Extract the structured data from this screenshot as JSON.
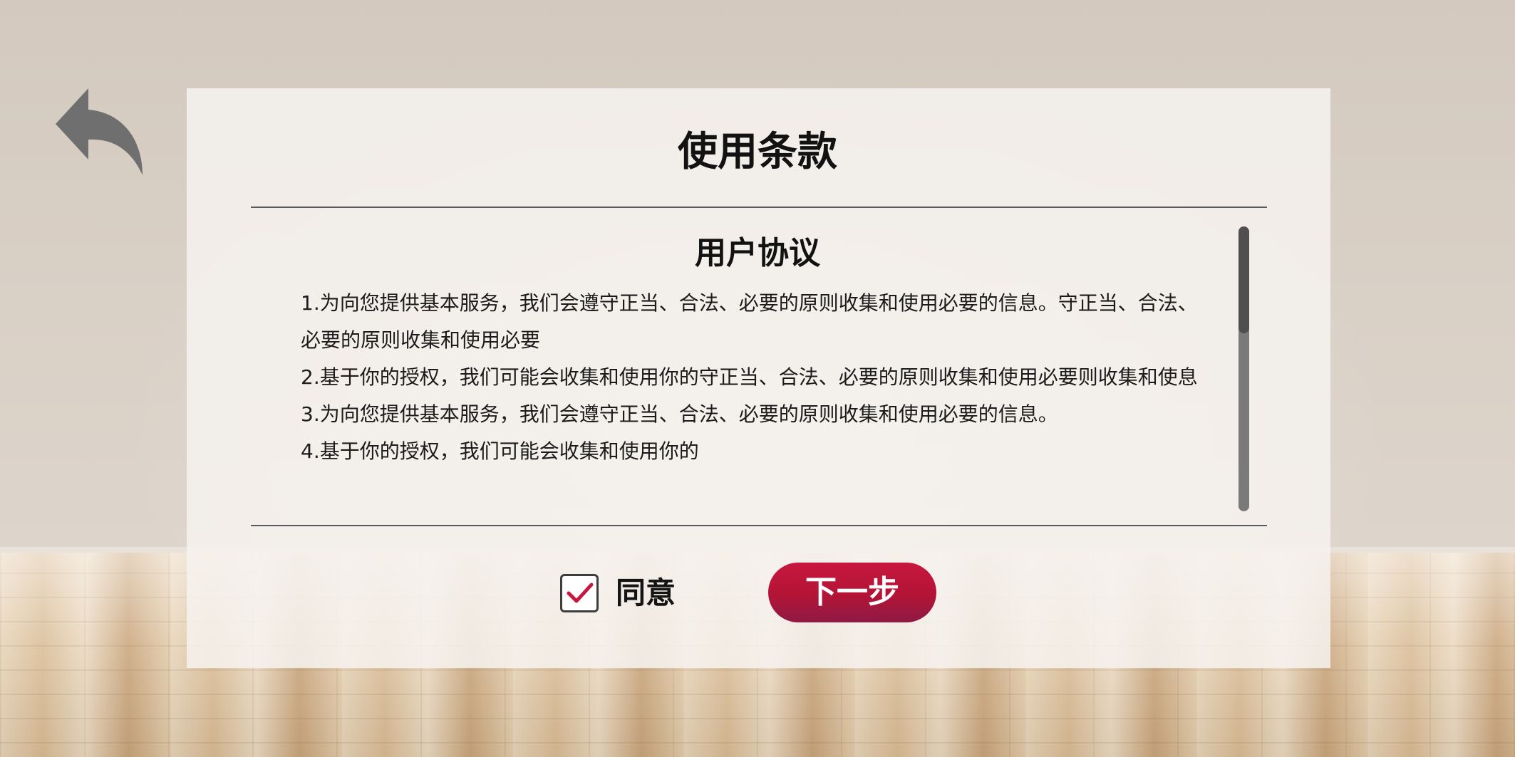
{
  "page": {
    "title": "使用条款",
    "back_icon": "back-arrow-icon"
  },
  "agreement": {
    "title": "用户协议",
    "paragraphs": [
      "1.为向您提供基本服务，我们会遵守正当、合法、必要的原则收集和使用必要的信息。守正当、合法、必要的原则收集和使用必要",
      "2.基于你的授权，我们可能会收集和使用你的守正当、合法、必要的原则收集和使用必要则收集和使息",
      "3.为向您提供基本服务，我们会遵守正当、合法、必要的原则收集和使用必要的信息。",
      "4.基于你的授权，我们可能会收集和使用你的"
    ]
  },
  "footer": {
    "agree_label": "同意",
    "agree_checked": true,
    "check_icon": "checkmark-icon",
    "next_label": "下一步"
  },
  "colors": {
    "accent": "#c8173f",
    "check": "#c8173f",
    "scroll_track": "#7a7a7a",
    "scroll_thumb": "#4f4f4f"
  }
}
